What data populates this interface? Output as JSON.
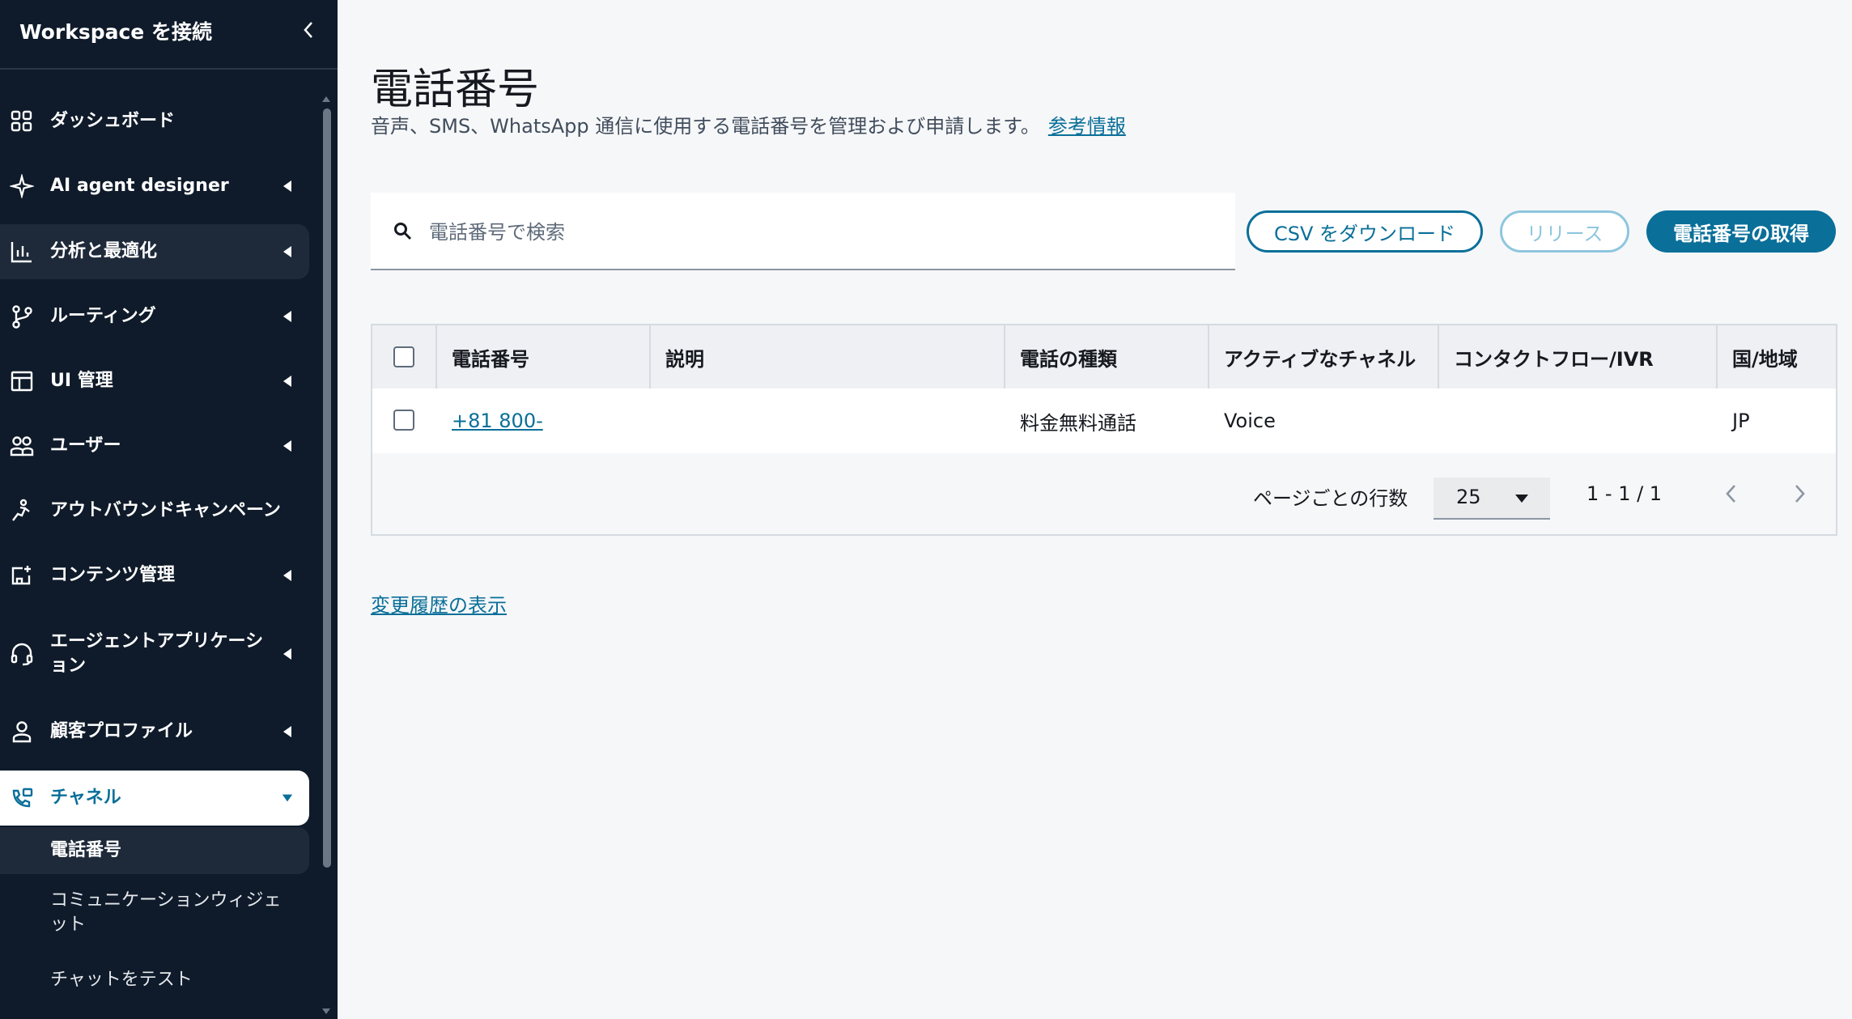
{
  "sidebar": {
    "title": "Workspace を接続",
    "items": [
      {
        "label": "ダッシュボード",
        "icon": "dashboard-icon",
        "has_caret": false
      },
      {
        "label": "AI agent designer",
        "icon": "sparkle-icon",
        "has_caret": true
      },
      {
        "label": "分析と最適化",
        "icon": "bar-chart-icon",
        "has_caret": true
      },
      {
        "label": "ルーティング",
        "icon": "routing-icon",
        "has_caret": true
      },
      {
        "label": "UI 管理",
        "icon": "layout-icon",
        "has_caret": true
      },
      {
        "label": "ユーザー",
        "icon": "users-icon",
        "has_caret": true
      },
      {
        "label": "アウトバウンドキャンペーン",
        "icon": "campaign-icon",
        "has_caret": false
      },
      {
        "label": "コンテンツ管理",
        "icon": "content-icon",
        "has_caret": true
      },
      {
        "label": "エージェントアプリケーション",
        "icon": "headset-icon",
        "has_caret": true
      },
      {
        "label": "顧客プロファイル",
        "icon": "person-icon",
        "has_caret": true
      },
      {
        "label": "チャネル",
        "icon": "phone-channel-icon",
        "has_caret": true
      }
    ],
    "subitems": [
      {
        "label": "電話番号"
      },
      {
        "label": "コミュニケーションウィジェット"
      },
      {
        "label": "チャットをテスト"
      }
    ]
  },
  "page": {
    "title": "電話番号",
    "description": "音声、SMS、WhatsApp 通信に使用する電話番号を管理および申請します。",
    "info_link": "参考情報"
  },
  "search": {
    "placeholder": "電話番号で検索",
    "value": ""
  },
  "buttons": {
    "csv": "CSV をダウンロード",
    "release": "リリース",
    "get": "電話番号の取得"
  },
  "table": {
    "headers": [
      "電話番号",
      "説明",
      "電話の種類",
      "アクティブなチャネル",
      "コンタクトフロー/IVR",
      "国/地域"
    ],
    "rows": [
      {
        "phone": "+81 800-",
        "description": "",
        "type": "料金無料通話",
        "channel": "Voice",
        "flow": "",
        "country": "JP"
      }
    ]
  },
  "pagination": {
    "rows_label": "ページごとの行数",
    "rows_per_page": "25",
    "range": "1 - 1 / 1"
  },
  "history_link": "変更履歴の表示",
  "colors": {
    "sidebar_bg": "#0f1b2a",
    "accent": "#0a6f99",
    "page_bg": "#f6f7f9"
  }
}
